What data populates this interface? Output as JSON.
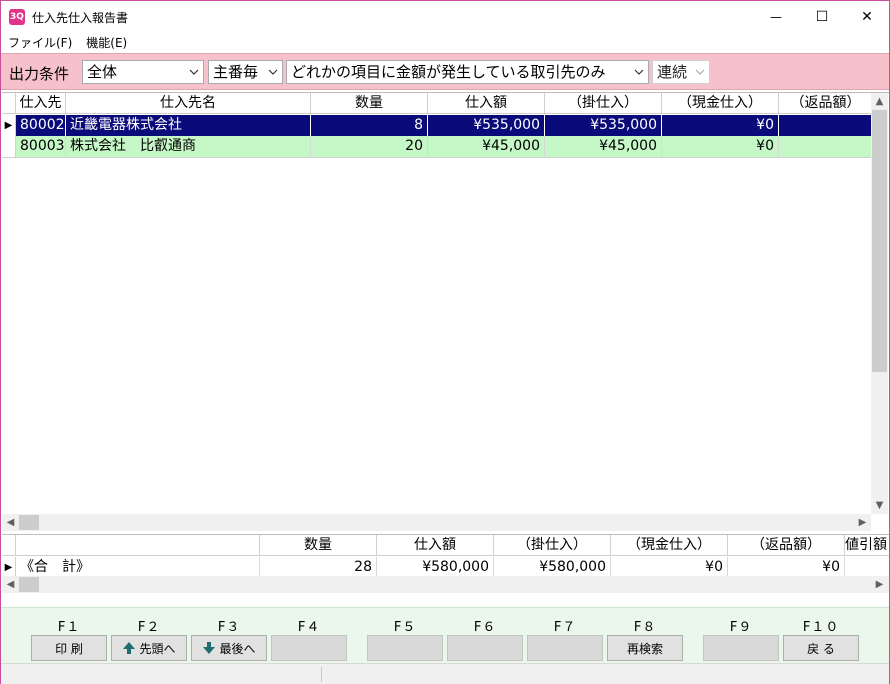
{
  "window": {
    "title": "仕入先仕入報告書",
    "app_icon_text": "3Q",
    "minimize_glyph": "—",
    "maximize_glyph": "☐",
    "close_glyph": "✕"
  },
  "menu": [
    {
      "label": "ファイル(F)"
    },
    {
      "label": "機能(E)"
    }
  ],
  "filter": {
    "label": "出力条件",
    "scope_value": "全体",
    "group_value": "主番毎",
    "condition_value": "どれかの項目に金額が発生している取引先のみ",
    "mode_value": "連続"
  },
  "grid": {
    "columns": [
      "仕入先",
      "仕入先名",
      "数量",
      "仕入額",
      "（掛仕入）",
      "（現金仕入）",
      "（返品額）"
    ],
    "rows": [
      {
        "code": "80002",
        "name": "近畿電器株式会社",
        "qty": "8",
        "amount": "¥535,000",
        "credit": "¥535,000",
        "cash": "¥0",
        "returns": ""
      },
      {
        "code": "80003",
        "name": "株式会社　比叡通商",
        "qty": "20",
        "amount": "¥45,000",
        "credit": "¥45,000",
        "cash": "¥0",
        "returns": ""
      }
    ],
    "current_row_marker": "▶"
  },
  "totals": {
    "columns": [
      "数量",
      "仕入額",
      "（掛仕入）",
      "（現金仕入）",
      "（返品額）",
      "値引額"
    ],
    "row": {
      "label": "《合　計》",
      "qty": "28",
      "amount": "¥580,000",
      "credit": "¥580,000",
      "cash": "¥0",
      "returns": "¥0"
    },
    "current_row_marker": "▶"
  },
  "function_keys": [
    {
      "key": "F１",
      "label": "印 刷"
    },
    {
      "key": "F２",
      "label": "先頭へ",
      "icon": "arrow-up-icon"
    },
    {
      "key": "F３",
      "label": "最後へ",
      "icon": "arrow-down-icon"
    },
    {
      "key": "F４",
      "label": ""
    },
    {
      "key": "F５",
      "label": ""
    },
    {
      "key": "F６",
      "label": ""
    },
    {
      "key": "F７",
      "label": ""
    },
    {
      "key": "F８",
      "label": "再検索"
    },
    {
      "key": "F９",
      "label": ""
    },
    {
      "key": "F１０",
      "label": "戻 る"
    }
  ],
  "colors": {
    "selected_row": "#0a0a7a",
    "alt_row": "#c6f7c6",
    "filter_bar": "#f7c1cc",
    "function_area": "#eaf7ea",
    "arrow_icon": "#1e6e6e"
  }
}
